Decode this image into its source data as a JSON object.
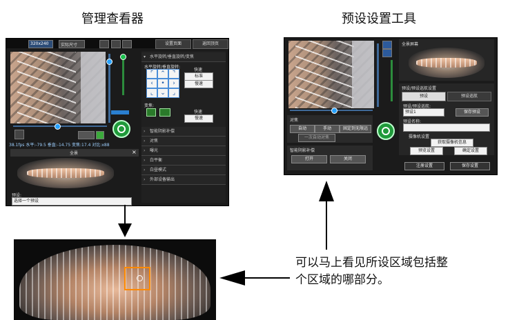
{
  "headings": {
    "left": "管理查看器",
    "right": "预设设置工具"
  },
  "annotation": {
    "line1": "可以马上看见所设区域包括整",
    "line2": "个区域的哪部分。"
  },
  "admin_viewer": {
    "toolbar": {
      "resolution": "320x240",
      "mode": "实际尺寸"
    },
    "tabs": [
      "设置页面",
      "返回顶页"
    ],
    "panel_rows": [
      "水平旋转/垂直旋转/变焦",
      "智能阴影补偿",
      "对焦",
      "曝光",
      "白平衡",
      "白昼模式",
      "外部设备输出"
    ],
    "pan_tilt_label": "水平旋转/垂直旋转:",
    "speed_label": "快速",
    "speed_options": [
      "标准",
      "慢速"
    ],
    "zoom_label": "变焦:",
    "zoom_speed_label": "快速",
    "zoom_speed_option": "慢速",
    "info_line": "38.1fps 水平:-79.5 垂直:-14.75 变焦:17.4 对比:x88",
    "overview_title": "全景",
    "preset_label": "预设:",
    "preset_value": "选择一个预设"
  },
  "preset_tool": {
    "overview_title": "全景屏幕",
    "preset_section_title": "预设/预设巡航设置",
    "tabs": [
      "预设",
      "预设巡航"
    ],
    "preset_number_label": "预设/预设巡航:",
    "preset_select": "预设1",
    "register_button": "保存预设",
    "name_label": "预设名称:",
    "camera_settings": "摄像机设置",
    "get_settings_button": "获取摄像机信息",
    "left_btn": "预览设置",
    "right_btn": "确定设置",
    "bottom_buttons": [
      "注册设置",
      "保存设置"
    ],
    "focus_title": "对焦",
    "focus_buttons": [
      "自动",
      "手动",
      "固定到无限远"
    ],
    "focus_buttons_row2": [
      "一次自动对焦"
    ],
    "smart_title": "智能阴影补偿",
    "smart_buttons": [
      "打开",
      "关闭"
    ]
  }
}
